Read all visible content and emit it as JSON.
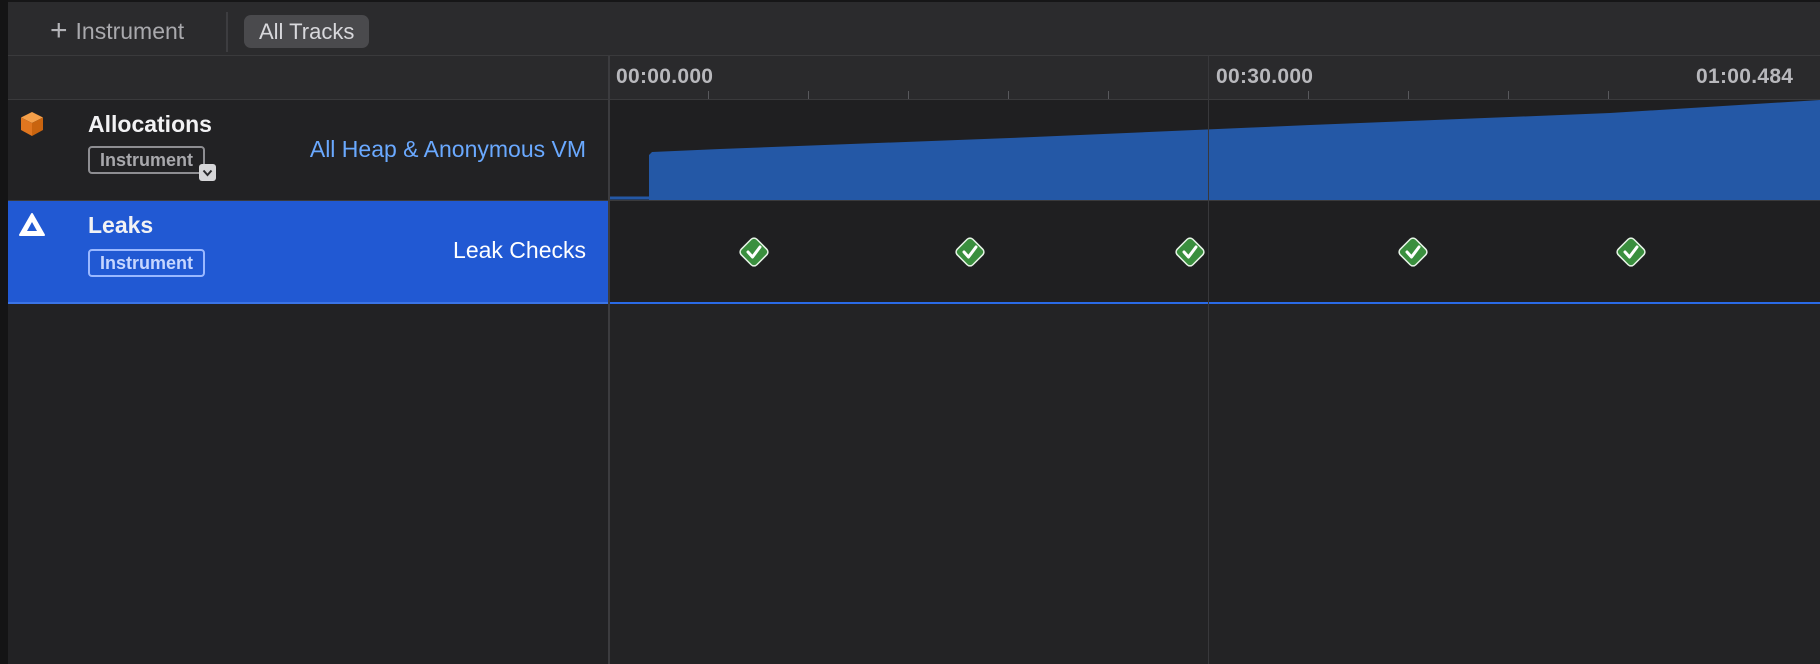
{
  "toolbar": {
    "add_instrument_label": "Instrument",
    "add_icon": "plus-icon",
    "all_tracks_label": "All Tracks"
  },
  "ruler": {
    "labels": [
      "00:00.000",
      "00:30.000",
      "01:00.484"
    ]
  },
  "tracks": [
    {
      "name": "Allocations",
      "badge": "Instrument",
      "detail": "All Heap & Anonymous VM",
      "icon": "cube-icon",
      "icon_color": "#f08a2c",
      "graph_color": "#2458a6",
      "selected": false
    },
    {
      "name": "Leaks",
      "badge": "Instrument",
      "detail": "Leak Checks",
      "icon": "warning-triangle-icon",
      "icon_color": "#ffffff",
      "graph_color": "#3a8f3e",
      "selected": true,
      "leak_check_count": 5
    }
  ],
  "colors": {
    "selection": "#2159d3",
    "alloc_fill": "#2458a6",
    "check_green": "#3a8f3e",
    "link_blue": "#6aa9ff"
  }
}
